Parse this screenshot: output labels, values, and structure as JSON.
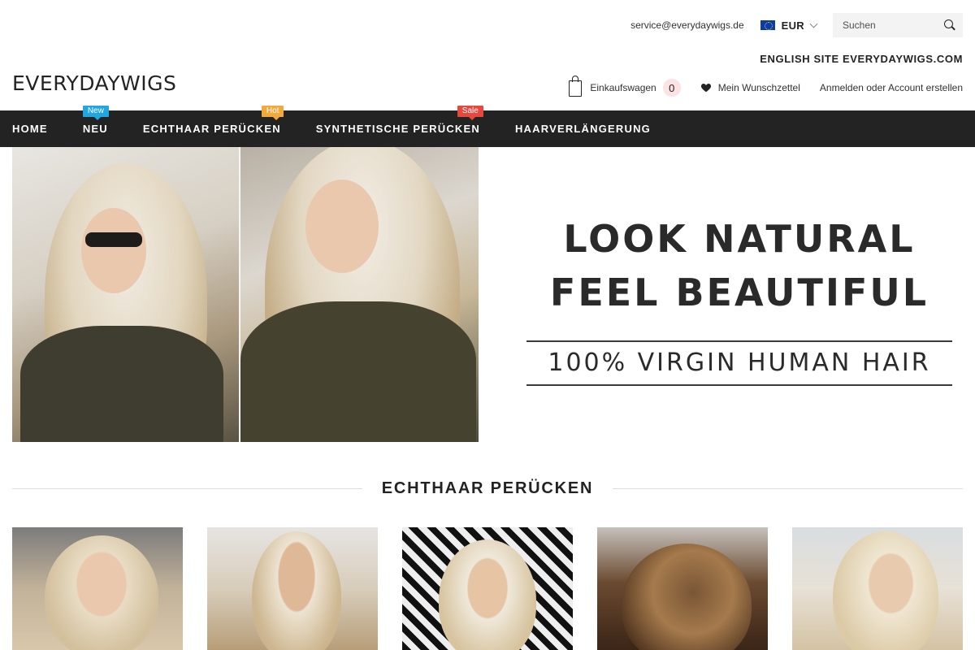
{
  "topbar": {
    "email": "service@everydaywigs.de",
    "currency": "EUR",
    "search_placeholder": "Suchen",
    "english_site": "ENGLISH SITE EVERYDAYWIGS.COM"
  },
  "header": {
    "logo": "EVERYDAYWIGS",
    "cart_label": "Einkaufswagen",
    "cart_count": "0",
    "wishlist_label": "Mein Wunschzettel",
    "account_label": "Anmelden oder Account erstellen"
  },
  "nav": {
    "items": [
      {
        "label": "HOME"
      },
      {
        "label": "NEU",
        "badge": "New"
      },
      {
        "label": "ECHTHAAR PERÜCKEN",
        "badge": "Hot"
      },
      {
        "label": "SYNTHETISCHE PERÜCKEN",
        "badge": "Sale"
      },
      {
        "label": "HAARVERLÄNGERUNG"
      }
    ]
  },
  "hero": {
    "line1": "LOOK NATURAL",
    "line2": "FEEL BEAUTIFUL",
    "sub": "100% VIRGIN HUMAN HAIR"
  },
  "section": {
    "title": "ECHTHAAR PERÜCKEN"
  },
  "colors": {
    "nav_bg": "#232323",
    "badge_new": "#22a6e0",
    "badge_hot": "#f3a83b",
    "badge_sale": "#e8473b",
    "cart_count_bg": "#fbe3e3"
  },
  "icons": {
    "search": "search-icon",
    "cart": "shopping-bag-icon",
    "wishlist": "heart-icon",
    "currency": "eu-flag-icon",
    "dropdown": "chevron-down-icon"
  }
}
